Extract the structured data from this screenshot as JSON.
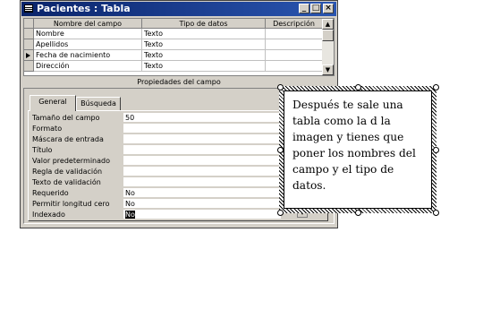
{
  "window": {
    "title": "Pacientes : Tabla",
    "controls": [
      "minimize",
      "maximize",
      "close"
    ]
  },
  "grid": {
    "columns": [
      "Nombre del campo",
      "Tipo de datos",
      "Descripción"
    ],
    "rows": [
      {
        "field": "Nombre",
        "type": "Texto",
        "description": "",
        "current": false
      },
      {
        "field": "Apellidos",
        "type": "Texto",
        "description": "",
        "current": false
      },
      {
        "field": "Fecha de nacimiento",
        "type": "Texto",
        "description": "",
        "current": true
      },
      {
        "field": "Dirección",
        "type": "Texto",
        "description": "",
        "current": false
      }
    ]
  },
  "properties": {
    "section_label": "Propiedades del campo",
    "tabs": [
      "General",
      "Búsqueda"
    ],
    "active_tab": "General",
    "rows": [
      {
        "label": "Tamaño del campo",
        "value": "50"
      },
      {
        "label": "Formato",
        "value": ""
      },
      {
        "label": "Máscara de entrada",
        "value": ""
      },
      {
        "label": "Título",
        "value": ""
      },
      {
        "label": "Valor predeterminado",
        "value": ""
      },
      {
        "label": "Regla de validación",
        "value": ""
      },
      {
        "label": "Texto de validación",
        "value": ""
      },
      {
        "label": "Requerido",
        "value": "No"
      },
      {
        "label": "Permitir longitud cero",
        "value": "No"
      },
      {
        "label": "Indexado",
        "value": "No"
      }
    ]
  },
  "callout": {
    "text": "Después te sale una tabla como la d la imagen y tienes que poner los nombres del campo y el tipo de datos."
  }
}
